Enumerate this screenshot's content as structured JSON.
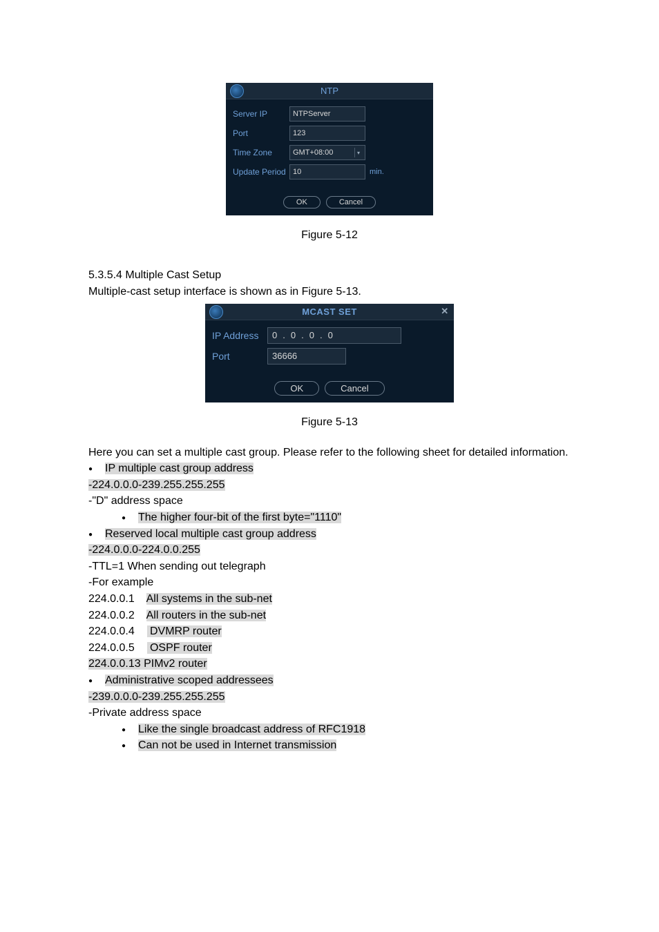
{
  "ntp_dialog": {
    "title": "NTP",
    "labels": {
      "server_ip": "Server IP",
      "port": "Port",
      "time_zone": "Time Zone",
      "update_period": "Update Period"
    },
    "values": {
      "server_ip": "NTPServer",
      "port": "123",
      "time_zone": "GMT+08:00",
      "update_period": "10"
    },
    "unit_min": "min.",
    "buttons": {
      "ok": "OK",
      "cancel": "Cancel"
    }
  },
  "caption1": "Figure 5-12",
  "section_heading": "5.3.5.4  Multiple Cast Setup",
  "section_intro": "Multiple-cast setup interface is shown as in Figure 5-13.",
  "mcast_dialog": {
    "title": "MCAST SET",
    "labels": {
      "ip_address": "IP Address",
      "port": "Port"
    },
    "ip_octets": [
      "0",
      "0",
      "0",
      "0"
    ],
    "port_value": "36666",
    "buttons": {
      "ok": "OK",
      "cancel": "Cancel"
    }
  },
  "caption2": "Figure 5-13",
  "text": {
    "intro2": "Here you can set a multiple cast group. Please refer to the following sheet for detailed information.",
    "b1": "IP multiple cast group address",
    "r1": "-224.0.0.0-239.255.255.255",
    "r2": "-\"D\" address space",
    "b2": "The higher four-bit of the first byte=\"1110\"",
    "b3": "Reserved local multiple cast group address",
    "r3": "-224.0.0.0-224.0.0.255",
    "r4": "-TTL=1 When sending out telegraph",
    "r5": "-For example",
    "ex1a": "224.0.0.1    ",
    "ex1b": "All systems in the sub-net",
    "ex2a": "224.0.0.2    ",
    "ex2b": "All routers in the sub-net",
    "ex3a": "224.0.0.4    ",
    "ex3b": " DVMRP router",
    "ex4a": "224.0.0.5    ",
    "ex4b": " OSPF router",
    "ex5": "224.0.0.13 PIMv2 router",
    "b4": "Administrative scoped addressees",
    "r6": "-239.0.0.0-239.255.255.255",
    "r7": "-Private address space",
    "b5": "Like the single broadcast address of RFC1918",
    "b6": "Can not be used in Internet transmission"
  }
}
